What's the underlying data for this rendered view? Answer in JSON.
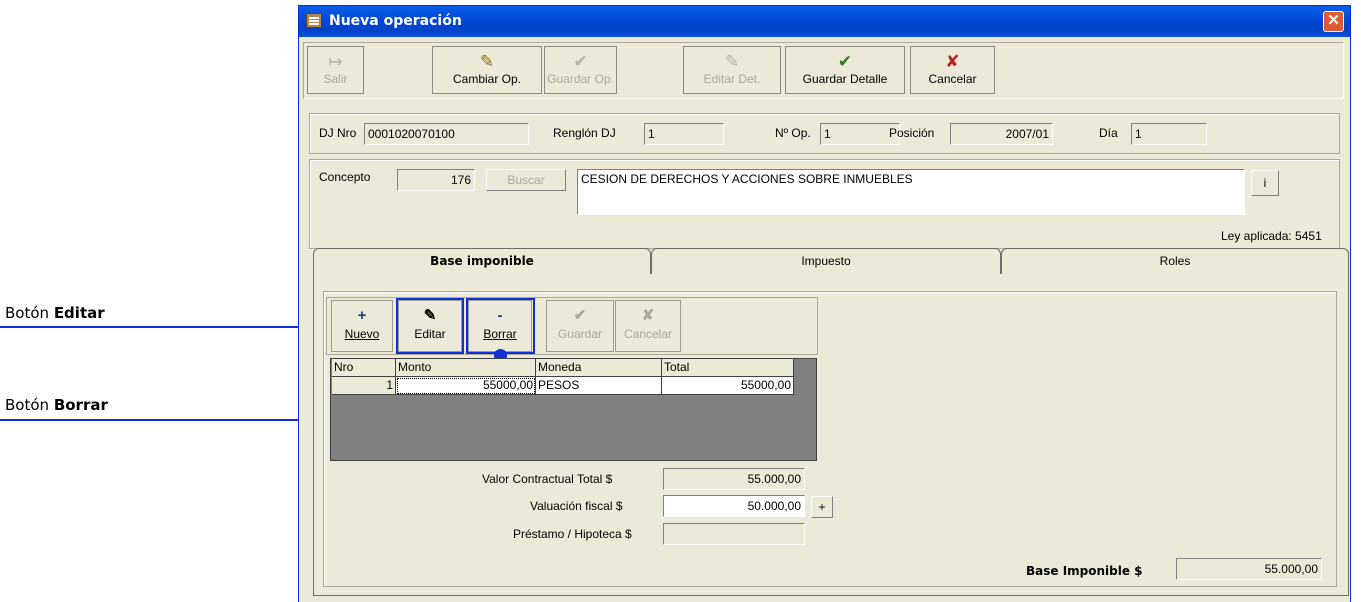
{
  "annotations": {
    "editar": {
      "prefix": "Botón ",
      "bold": "Editar"
    },
    "borrar": {
      "prefix": "Botón ",
      "bold": "Borrar"
    }
  },
  "window": {
    "title": "Nueva operación",
    "close": "✕"
  },
  "toolbar": {
    "salir": {
      "label": "Salir",
      "icon": "↦",
      "enabled": false
    },
    "cambiar": {
      "label": "Cambiar Op.",
      "icon": "✎",
      "enabled": true
    },
    "guardar_op": {
      "label": "Guardar Op.",
      "icon": "✔",
      "enabled": false
    },
    "editar_det": {
      "label": "Editar Det.",
      "icon": "✎",
      "enabled": false
    },
    "guardar_detalle": {
      "label": "Guardar Detalle",
      "icon": "✔",
      "enabled": true
    },
    "cancelar": {
      "label": "Cancelar",
      "icon": "✘",
      "enabled": true
    }
  },
  "header": {
    "dj_nro_label": "DJ Nro",
    "dj_nro": "0001020070100",
    "renglon_label": "Renglón DJ",
    "renglon": "1",
    "nro_op_label": "Nº Op.",
    "nro_op": "1",
    "posicion_label": "Posición",
    "posicion": "2007/01",
    "dia_label": "Día",
    "dia": "1"
  },
  "concepto": {
    "label": "Concepto",
    "code": "176",
    "buscar": "Buscar",
    "description": "CESION DE DERECHOS Y ACCIONES SOBRE INMUEBLES",
    "info": "i",
    "ley": "Ley aplicada: 5451"
  },
  "tabs": [
    "Base imponible",
    "Impuesto",
    "Roles"
  ],
  "inner_toolbar": {
    "nuevo": {
      "label": "Nuevo",
      "icon": "+"
    },
    "editar": {
      "label": "Editar",
      "icon": "✎"
    },
    "borrar": {
      "label": "Borrar",
      "icon": "-"
    },
    "guardar": {
      "label": "Guardar",
      "icon": "✔"
    },
    "cancelar": {
      "label": "Cancelar",
      "icon": "✘"
    }
  },
  "grid": {
    "columns": [
      "Nro",
      "Monto",
      "Moneda",
      "Total"
    ],
    "rows": [
      {
        "nro": "1",
        "monto": "55000,00",
        "moneda": "PESOS",
        "total": "55000,00"
      }
    ]
  },
  "totals": {
    "valor_label": "Valor Contractual Total $",
    "valor": "55.000,00",
    "valuacion_label": "Valuación fiscal $",
    "valuacion": "50.000,00",
    "plus": "+",
    "prestamo_label": "Préstamo / Hipoteca $",
    "prestamo": "",
    "base_label": "Base Imponible $",
    "base": "55.000,00"
  }
}
